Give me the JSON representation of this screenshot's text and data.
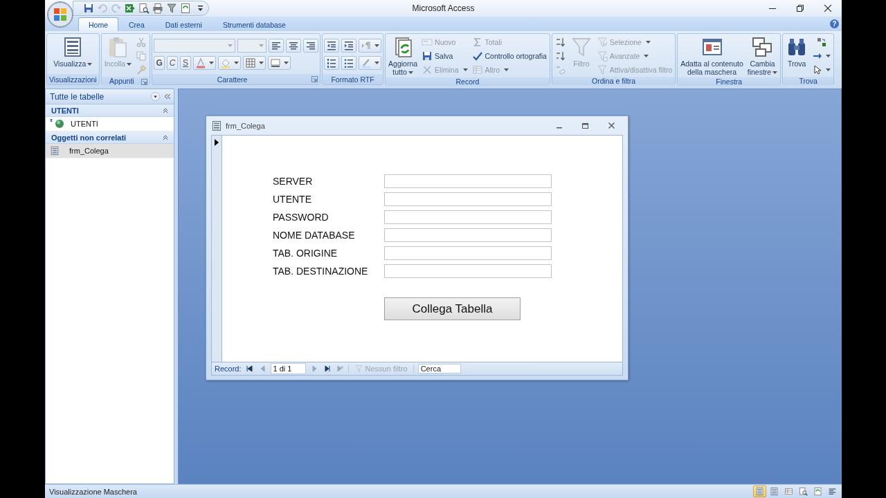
{
  "window": {
    "title": "Microsoft Access",
    "help": "?"
  },
  "quick_access": [
    {
      "disabled": false
    },
    {
      "disabled": true
    },
    {
      "disabled": true
    },
    {
      "disabled": false
    },
    {
      "disabled": false
    },
    {
      "disabled": false
    },
    {
      "disabled": false
    },
    {
      "disabled": false
    }
  ],
  "ribbon": {
    "tabs": [
      {
        "label": "Home",
        "selected": true
      },
      {
        "label": "Crea",
        "selected": false
      },
      {
        "label": "Dati esterni",
        "selected": false
      },
      {
        "label": "Strumenti database",
        "selected": false
      }
    ],
    "groups": [
      {
        "label": "Visualizzazioni",
        "launcher": false,
        "blocks": [
          {
            "kind": "large",
            "label": "Visualizza",
            "disabled": false,
            "dropdown": true
          }
        ]
      },
      {
        "label": "Appunti",
        "launcher": true,
        "blocks": [
          {
            "kind": "large",
            "label": "Incolla",
            "disabled": true,
            "dropdown": true
          },
          {
            "kind": "stack",
            "items": [
              {
                "kind": "tool",
                "disabled": true,
                "dropdown": false
              },
              {
                "kind": "tool",
                "disabled": true,
                "dropdown": false
              },
              {
                "kind": "tool",
                "disabled": true,
                "dropdown": false
              }
            ]
          }
        ]
      },
      {
        "label": "Carattere",
        "launcher": true,
        "blocks": [
          {
            "kind": "rows",
            "rows": [
              [
                {
                  "kind": "font_combo",
                  "disabled": true
                },
                {
                  "kind": "size_combo",
                  "disabled": true
                },
                {
                  "kind": "tool",
                  "disabled": false,
                  "dropdown": false
                },
                {
                  "kind": "tool",
                  "disabled": false,
                  "dropdown": false
                },
                {
                  "kind": "tool",
                  "disabled": false,
                  "dropdown": false
                }
              ],
              [
                {
                  "kind": "letter",
                  "label": "G",
                  "disabled": false
                },
                {
                  "kind": "letter",
                  "label": "C",
                  "disabled": false
                },
                {
                  "kind": "letter",
                  "label": "S",
                  "disabled": false
                },
                {
                  "kind": "tool",
                  "disabled": true,
                  "dropdown": true
                },
                {
                  "kind": "tool",
                  "disabled": true,
                  "dropdown": true
                },
                {
                  "kind": "tool",
                  "disabled": false,
                  "dropdown": true
                },
                {
                  "kind": "tool",
                  "disabled": false,
                  "dropdown": true
                }
              ]
            ]
          }
        ]
      },
      {
        "label": "Formato RTF",
        "launcher": false,
        "blocks": [
          {
            "kind": "rows",
            "rows": [
              [
                {
                  "kind": "tool",
                  "disabled": false,
                  "dropdown": false
                },
                {
                  "kind": "tool",
                  "disabled": false,
                  "dropdown": false
                },
                {
                  "kind": "tool",
                  "disabled": true,
                  "dropdown": true
                }
              ],
              [
                {
                  "kind": "tool",
                  "disabled": false,
                  "dropdown": false
                },
                {
                  "kind": "tool",
                  "disabled": false,
                  "dropdown": false
                },
                {
                  "kind": "tool",
                  "disabled": true,
                  "dropdown": true
                }
              ]
            ]
          }
        ]
      },
      {
        "label": "Record",
        "launcher": false,
        "blocks": [
          {
            "kind": "large",
            "label": "Aggiorna\ntutto",
            "disabled": false,
            "dropdown": true
          },
          {
            "kind": "stack",
            "items": [
              {
                "kind": "small",
                "label": "Nuovo",
                "disabled": true,
                "dropdown": false
              },
              {
                "kind": "small",
                "label": "Salva",
                "disabled": false,
                "dropdown": false
              },
              {
                "kind": "small",
                "label": "Elimina",
                "disabled": true,
                "dropdown": true
              }
            ]
          },
          {
            "kind": "stack",
            "items": [
              {
                "kind": "small",
                "label": "Totali",
                "disabled": true,
                "dropdown": false
              },
              {
                "kind": "small",
                "label": "Controllo ortografia",
                "disabled": false,
                "dropdown": false
              },
              {
                "kind": "small",
                "label": "Altro",
                "disabled": true,
                "dropdown": true
              }
            ]
          }
        ]
      },
      {
        "label": "Ordina e filtra",
        "launcher": false,
        "blocks": [
          {
            "kind": "stack",
            "items": [
              {
                "kind": "tool",
                "disabled": false,
                "dropdown": false
              },
              {
                "kind": "tool",
                "disabled": false,
                "dropdown": false
              },
              {
                "kind": "tool",
                "disabled": true,
                "dropdown": false
              }
            ]
          },
          {
            "kind": "large",
            "label": "Filtro",
            "disabled": true,
            "dropdown": false
          },
          {
            "kind": "stack",
            "items": [
              {
                "kind": "small",
                "label": "Selezione",
                "disabled": true,
                "dropdown": true
              },
              {
                "kind": "small",
                "label": "Avanzate",
                "disabled": true,
                "dropdown": true
              },
              {
                "kind": "small",
                "label": "Attiva/disattiva filtro",
                "disabled": true,
                "dropdown": false
              }
            ]
          }
        ]
      },
      {
        "label": "Finestra",
        "launcher": false,
        "blocks": [
          {
            "kind": "large",
            "label": "Adatta al contenuto\ndella maschera",
            "disabled": false,
            "dropdown": false
          },
          {
            "kind": "large",
            "label": "Cambia\nfinestre",
            "disabled": false,
            "dropdown": true
          }
        ]
      },
      {
        "label": "Trova",
        "launcher": false,
        "blocks": [
          {
            "kind": "large",
            "label": "Trova",
            "disabled": false,
            "dropdown": false
          },
          {
            "kind": "stack",
            "items": [
              {
                "kind": "tool",
                "disabled": false,
                "dropdown": false
              },
              {
                "kind": "tool",
                "disabled": false,
                "dropdown": true
              },
              {
                "kind": "tool",
                "disabled": false,
                "dropdown": true
              }
            ]
          }
        ]
      }
    ]
  },
  "navigation": {
    "title": "Tutte le tabelle",
    "groups": [
      {
        "label": "UTENTI",
        "expanded": true,
        "items": [
          {
            "label": "UTENTI",
            "kind": "linked_table",
            "selected": false
          }
        ]
      },
      {
        "label": "Oggetti non correlati",
        "expanded": true,
        "items": [
          {
            "label": "frm_Colega",
            "kind": "form",
            "selected": true
          }
        ]
      }
    ]
  },
  "form": {
    "title": "frm_Colega",
    "fields": [
      {
        "label": "SERVER"
      },
      {
        "label": "UTENTE"
      },
      {
        "label": "PASSWORD"
      },
      {
        "label": "NOME DATABASE"
      },
      {
        "label": "TAB. ORIGINE"
      },
      {
        "label": "TAB. DESTINAZIONE"
      }
    ],
    "button": "Collega Tabella",
    "navigator": {
      "label": "Record:",
      "buttons": [
        {
          "disabled": false
        },
        {
          "disabled": true
        },
        {
          "disabled": true
        },
        {
          "disabled": false
        },
        {
          "disabled": true
        }
      ],
      "position": "1 di 1",
      "filter": {
        "label": "Nessun filtro",
        "disabled": true
      },
      "search_placeholder": "Cerca"
    }
  },
  "status_bar": {
    "text": "Visualizzazione Maschera",
    "views": [
      {
        "selected": true
      },
      {
        "selected": false
      },
      {
        "selected": false
      },
      {
        "selected": false
      },
      {
        "selected": false
      },
      {
        "selected": false
      }
    ]
  }
}
